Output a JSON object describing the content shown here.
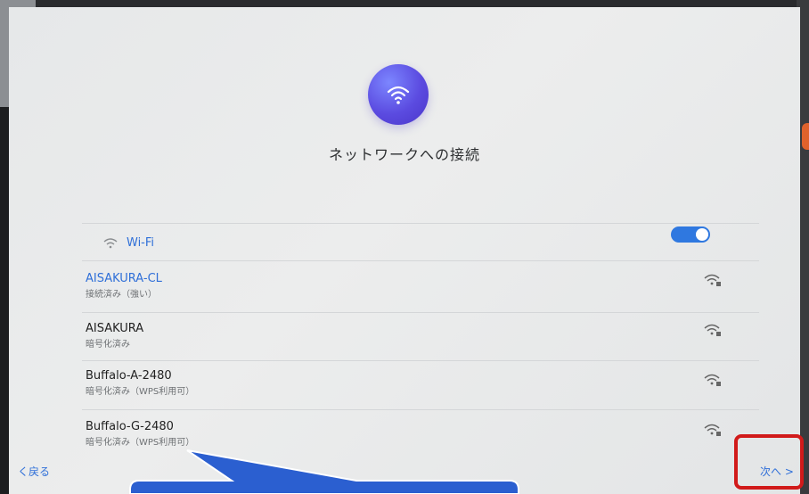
{
  "page": {
    "title": "ネットワークへの接続"
  },
  "wifi": {
    "label": "Wi-Fi",
    "enabled": true
  },
  "networks": [
    {
      "name": "AISAKURA-CL",
      "status": "接続済み（強い）",
      "connected": true
    },
    {
      "name": "AISAKURA",
      "status": "暗号化済み",
      "connected": false
    },
    {
      "name": "Buffalo-A-2480",
      "status": "暗号化済み（WPS利用可）",
      "connected": false
    },
    {
      "name": "Buffalo-G-2480",
      "status": "暗号化済み（WPS利用可）",
      "connected": false
    }
  ],
  "nav": {
    "back_label": "く戻る",
    "next_label": "次へ >"
  },
  "colors": {
    "accent": "#2f6fd8",
    "highlight": "#d11a1a",
    "callout": "#2b5fd0"
  },
  "icons": {
    "header": "wifi-icon",
    "signal": "wifi-lock-icon"
  }
}
